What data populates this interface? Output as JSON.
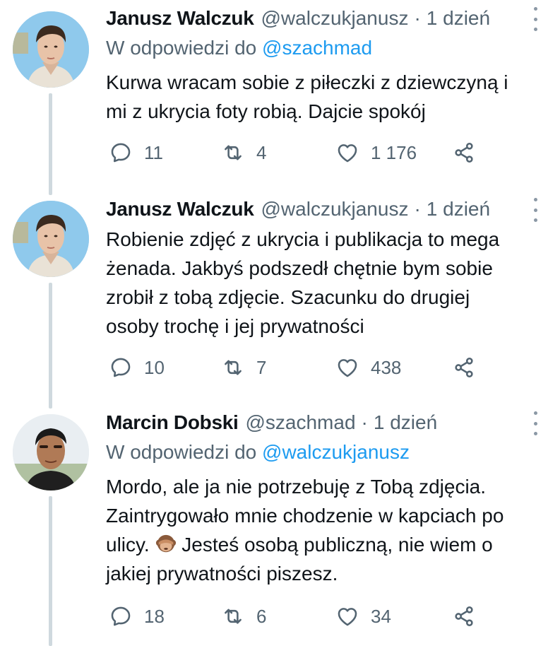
{
  "tweets": [
    {
      "name": "Janusz Walczuk",
      "handle": "@walczukjanusz",
      "dot": "·",
      "time": "1 dzień",
      "reply_prefix": "W odpowiedzi do",
      "reply_handle": "@szachmad",
      "lines": [
        "Kurwa wracam sobie z piłeczki z dziewczyną i",
        "mi z ukrycia foty robią. Dajcie spokój"
      ],
      "replies": "11",
      "retweets": "4",
      "likes": "1 176"
    },
    {
      "name": "Janusz Walczuk",
      "handle": "@walczukjanusz",
      "dot": "·",
      "time": "1 dzień",
      "lines": [
        "Robienie zdjęć z ukrycia i publikacja to mega",
        "żenada. Jakbyś podszedł chętnie bym sobie",
        "zrobił z tobą zdjęcie. Szacunku do drugiej",
        "osoby trochę i jej prywatności"
      ],
      "replies": "10",
      "retweets": "7",
      "likes": "438"
    },
    {
      "name": "Marcin Dobski",
      "handle": "@szachmad",
      "dot": "·",
      "time": "1 dzień",
      "reply_prefix": "W odpowiedzi do",
      "reply_handle": "@walczukjanusz",
      "lines": [
        "Mordo, ale ja nie potrzebuję z Tobą zdjęcia.",
        "Zaintrygowało mnie chodzenie w kapciach po"
      ],
      "line3_before": "ulicy.",
      "line3_after": "Jesteś osobą publiczną, nie wiem o",
      "line4": "jakiej prywatności piszesz.",
      "emoji": "see-no-evil-monkey-icon",
      "replies": "18",
      "retweets": "6",
      "likes": "34"
    }
  ]
}
